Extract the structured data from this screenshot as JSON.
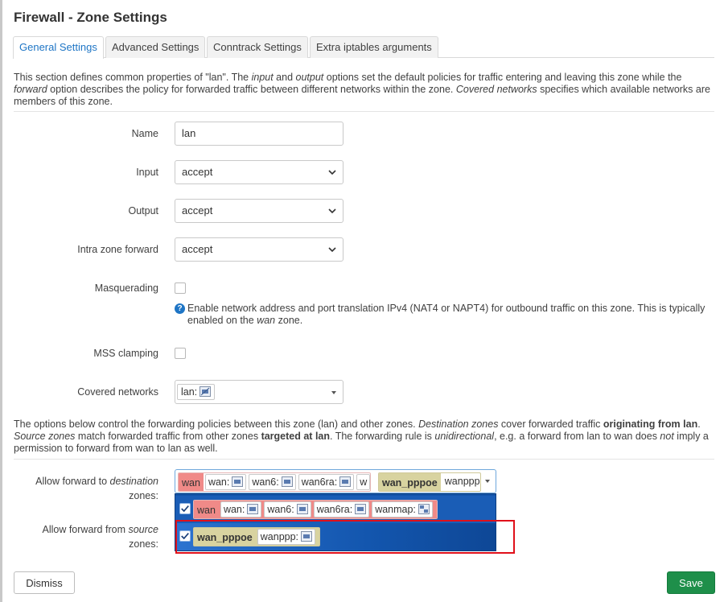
{
  "dialog": {
    "title": "Firewall - Zone Settings"
  },
  "tabs": [
    {
      "label": "General Settings",
      "active": true
    },
    {
      "label": "Advanced Settings"
    },
    {
      "label": "Conntrack Settings"
    },
    {
      "label": "Extra iptables arguments"
    }
  ],
  "intro": {
    "p1": "This section defines common properties of \"lan\". The ",
    "input": "input",
    "p2": " and ",
    "output": "output",
    "p3": " options set the default policies for traffic entering and leaving this zone while the ",
    "forward": "forward",
    "p4": " option describes the policy for forwarded traffic between different networks within the zone. ",
    "covered": "Covered networks",
    "p5": " specifies which available networks are members of this zone."
  },
  "form": {
    "name": {
      "label": "Name",
      "value": "lan"
    },
    "input": {
      "label": "Input",
      "value": "accept"
    },
    "output": {
      "label": "Output",
      "value": "accept"
    },
    "intra": {
      "label": "Intra zone forward",
      "value": "accept"
    },
    "masq": {
      "label": "Masquerading",
      "help_p1": "Enable network address and port translation IPv4 (NAT4 or NAPT4) for outbound traffic on this zone. This is typically enabled on the ",
      "help_wan": "wan",
      "help_p2": " zone."
    },
    "mss": {
      "label": "MSS clamping"
    },
    "covered": {
      "label": "Covered networks",
      "value": "lan:"
    }
  },
  "forwarding_intro": {
    "p1": "The options below control the forwarding policies between this zone (lan) and other zones. ",
    "dest": "Destination zones",
    "p2": " cover forwarded traffic ",
    "orig": "originating from lan",
    "p3": ". ",
    "src": "Source zones",
    "p4": " match forwarded traffic from other zones ",
    "target": "targeted at lan",
    "p5": ". The forwarding rule is ",
    "uni": "unidirectional",
    "p6": ", e.g. a forward from lan to wan does ",
    "not": "not",
    "p7": " imply a permission to forward from wan to lan as well."
  },
  "fwd_dest": {
    "label_a": "Allow forward to ",
    "label_em": "destination",
    "label_b": "zones:",
    "selected": {
      "wan_zone": "wan",
      "wan_ifs": [
        "wan:",
        "wan6:",
        "wan6ra:",
        "w"
      ],
      "pppoe_zone": "wan_pppoe",
      "pppoe_ifs": [
        "wanppp"
      ]
    }
  },
  "fwd_src": {
    "label_a": "Allow forward from ",
    "label_em": "source",
    "label_b": "zones:"
  },
  "dropdown": {
    "option1": {
      "zone": "wan",
      "ifs": [
        "wan:",
        "wan6:",
        "wan6ra:",
        "wanmap:"
      ]
    },
    "option2": {
      "zone": "wan_pppoe",
      "ifs": [
        "wanppp:"
      ]
    }
  },
  "buttons": {
    "dismiss": "Dismiss",
    "save": "Save"
  },
  "colors": {
    "accent": "#1e75c5",
    "save": "#1e8f4a",
    "wan_zone": "#f08a88",
    "pppoe_zone": "#d8d3a0",
    "highlight": "#e0101a"
  }
}
